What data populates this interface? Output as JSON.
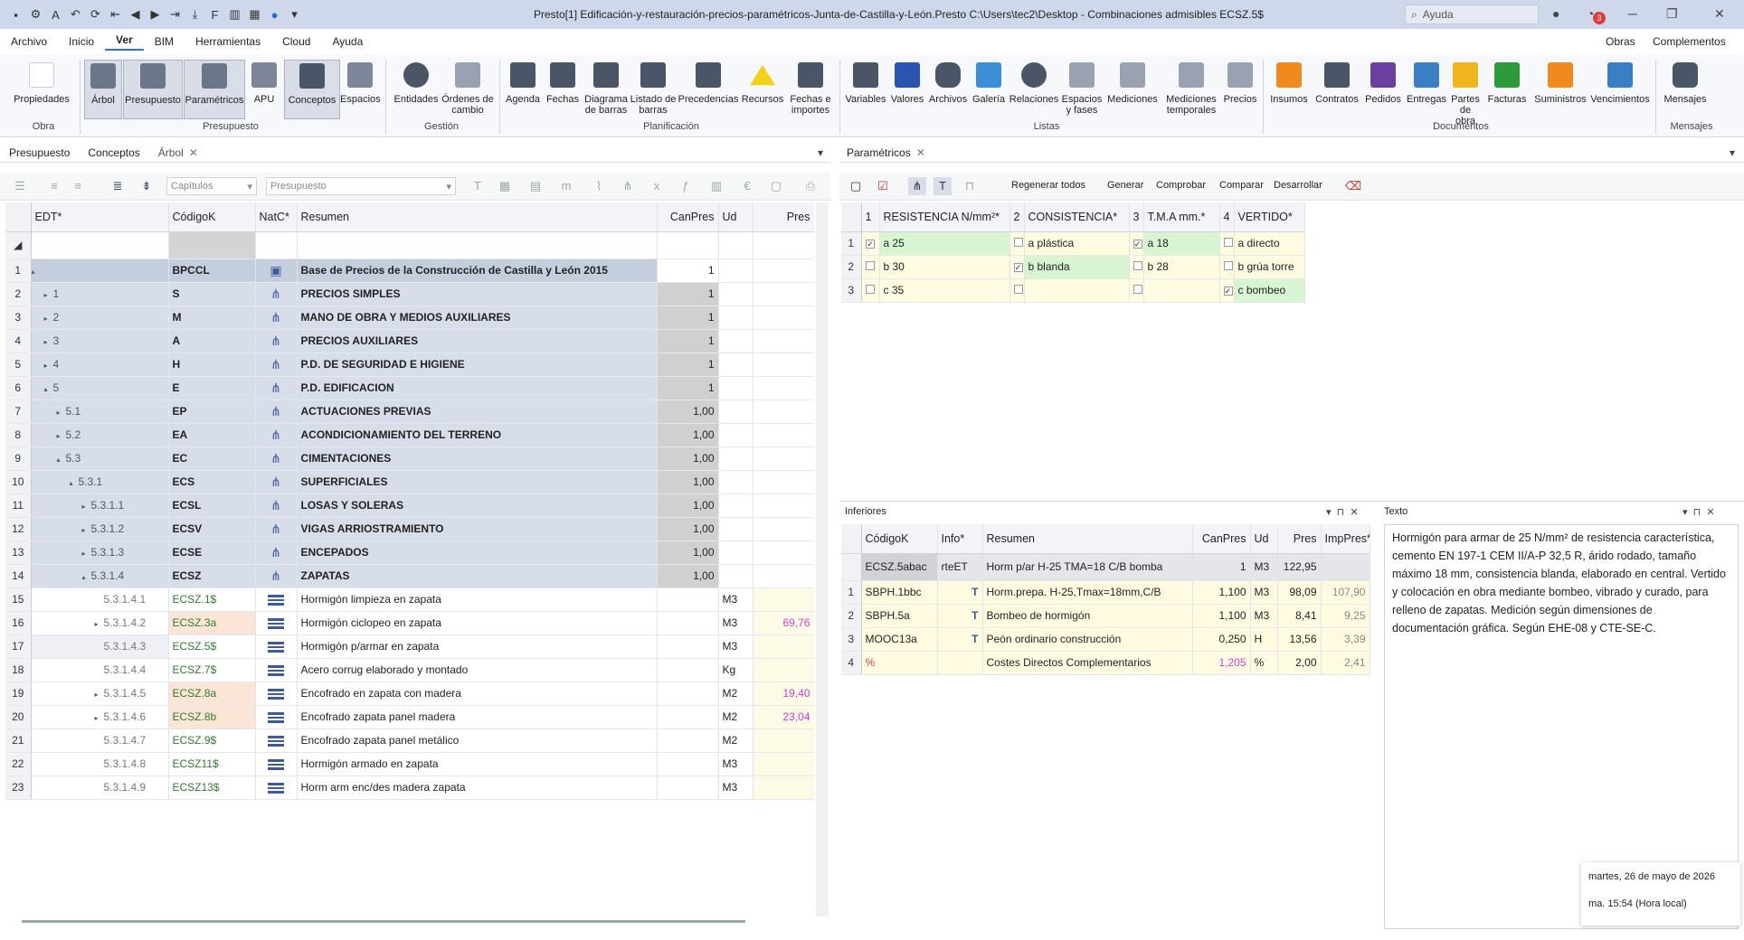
{
  "titlebar": {
    "title": "Presto[1] Edificación-y-restauración-precios-paramétricos-Junta-de-Castilla-y-León.Presto C:\\Users\\tec2\\Desktop - Combinaciones admisibles ECSZ.5$",
    "help_placeholder": "Ayuda",
    "notif_count": "3"
  },
  "menu": {
    "items": [
      "Archivo",
      "Inicio",
      "Ver",
      "BIM",
      "Herramientas",
      "Cloud",
      "Ayuda"
    ],
    "right": [
      "Obras",
      "Complementos"
    ]
  },
  "ribbon": {
    "buttons": [
      "Propiedades",
      "Árbol",
      "Presupuesto",
      "Paramétricos",
      "APU",
      "Conceptos",
      "Espacios",
      "Entidades",
      "Órdenes de cambio",
      "Agenda",
      "Fechas",
      "Diagrama de barras",
      "Listado de barras",
      "Precedencias",
      "Recursos",
      "Fechas e importes",
      "Variables",
      "Valores",
      "Archivos",
      "Galería",
      "Relaciones",
      "Espacios y fases",
      "Mediciones",
      "Mediciones temporales",
      "Precios",
      "Insumos",
      "Contratos",
      "Pedidos",
      "Entregas",
      "Partes de obra",
      "Facturas",
      "Suministros",
      "Vencimientos",
      "Mensajes"
    ],
    "groups": [
      "Obra",
      "Presupuesto",
      "Gestión",
      "Planificación",
      "Listas",
      "Documentos",
      "Mensajes"
    ]
  },
  "left_tabs": [
    "Presupuesto",
    "Conceptos",
    "Árbol"
  ],
  "left_toolbar": {
    "sel1": "Capítulos",
    "sel2": "Presupuesto"
  },
  "tree_table": {
    "headers": [
      "EDT*",
      "CódigoK",
      "NatC*",
      "Resumen",
      "CanPres",
      "Ud",
      "Pres"
    ],
    "rows": [
      {
        "n": "1",
        "edt": "",
        "code": "BPCCL",
        "sum": "Base de Precios de la Construcción de Castilla y León 2015",
        "can": "1",
        "ud": "",
        "pres": ""
      },
      {
        "n": "2",
        "edt": "1",
        "code": "S",
        "sum": "PRECIOS SIMPLES",
        "can": "1",
        "ud": "",
        "pres": ""
      },
      {
        "n": "3",
        "edt": "2",
        "code": "M",
        "sum": "MANO DE OBRA Y MEDIOS AUXILIARES",
        "can": "1",
        "ud": "",
        "pres": ""
      },
      {
        "n": "4",
        "edt": "3",
        "code": "A",
        "sum": "PRECIOS AUXILIARES",
        "can": "1",
        "ud": "",
        "pres": ""
      },
      {
        "n": "5",
        "edt": "4",
        "code": "H",
        "sum": "P.D. DE SEGURIDAD E HIGIENE",
        "can": "1",
        "ud": "",
        "pres": ""
      },
      {
        "n": "6",
        "edt": "5",
        "code": "E",
        "sum": "P.D. EDIFICACION",
        "can": "1",
        "ud": "",
        "pres": ""
      },
      {
        "n": "7",
        "edt": "5.1",
        "code": "EP",
        "sum": "ACTUACIONES PREVIAS",
        "can": "1,00",
        "ud": "",
        "pres": ""
      },
      {
        "n": "8",
        "edt": "5.2",
        "code": "EA",
        "sum": "ACONDICIONAMIENTO DEL TERRENO",
        "can": "1,00",
        "ud": "",
        "pres": ""
      },
      {
        "n": "9",
        "edt": "5.3",
        "code": "EC",
        "sum": "CIMENTACIONES",
        "can": "1,00",
        "ud": "",
        "pres": ""
      },
      {
        "n": "10",
        "edt": "5.3.1",
        "code": "ECS",
        "sum": "SUPERFICIALES",
        "can": "1,00",
        "ud": "",
        "pres": ""
      },
      {
        "n": "11",
        "edt": "5.3.1.1",
        "code": "ECSL",
        "sum": "LOSAS Y SOLERAS",
        "can": "1,00",
        "ud": "",
        "pres": ""
      },
      {
        "n": "12",
        "edt": "5.3.1.2",
        "code": "ECSV",
        "sum": "VIGAS ARRIOSTRAMIENTO",
        "can": "1,00",
        "ud": "",
        "pres": ""
      },
      {
        "n": "13",
        "edt": "5.3.1.3",
        "code": "ECSE",
        "sum": "ENCEPADOS",
        "can": "1,00",
        "ud": "",
        "pres": ""
      },
      {
        "n": "14",
        "edt": "5.3.1.4",
        "code": "ECSZ",
        "sum": "ZAPATAS",
        "can": "1,00",
        "ud": "",
        "pres": ""
      },
      {
        "n": "15",
        "edt": "5.3.1.4.1",
        "code": "ECSZ.1$",
        "sum": "Hormigón limpieza en zapata",
        "can": "",
        "ud": "M3",
        "pres": ""
      },
      {
        "n": "16",
        "edt": "5.3.1.4.2",
        "code": "ECSZ.3a",
        "sum": "Hormigón ciclopeo en zapata",
        "can": "",
        "ud": "M3",
        "pres": "69,76"
      },
      {
        "n": "17",
        "edt": "5.3.1.4.3",
        "code": "ECSZ.5$",
        "sum": "Hormigón p/armar en zapata",
        "can": "",
        "ud": "M3",
        "pres": ""
      },
      {
        "n": "18",
        "edt": "5.3.1.4.4",
        "code": "ECSZ.7$",
        "sum": "Acero corrug elaborado y montado",
        "can": "",
        "ud": "Kg",
        "pres": ""
      },
      {
        "n": "19",
        "edt": "5.3.1.4.5",
        "code": "ECSZ.8a",
        "sum": "Encofrado en zapata con madera",
        "can": "",
        "ud": "M2",
        "pres": "19,40"
      },
      {
        "n": "20",
        "edt": "5.3.1.4.6",
        "code": "ECSZ.8b",
        "sum": "Encofrado zapata panel madera",
        "can": "",
        "ud": "M2",
        "pres": "23,04"
      },
      {
        "n": "21",
        "edt": "5.3.1.4.7",
        "code": "ECSZ.9$",
        "sum": "Encofrado zapata panel metálico",
        "can": "",
        "ud": "M2",
        "pres": ""
      },
      {
        "n": "22",
        "edt": "5.3.1.4.8",
        "code": "ECSZ11$",
        "sum": "Hormigón armado en zapata",
        "can": "",
        "ud": "M3",
        "pres": ""
      },
      {
        "n": "23",
        "edt": "5.3.1.4.9",
        "code": "ECSZ13$",
        "sum": "Horm arm enc/des madera zapata",
        "can": "",
        "ud": "M3",
        "pres": ""
      }
    ]
  },
  "param": {
    "tab": "Paramétricos",
    "toolbar": [
      "Regenerar todos",
      "Generar",
      "Comprobar",
      "Comparar",
      "Desarrollar"
    ],
    "headers": [
      "1",
      "RESISTENCIA N/mm²*",
      "2",
      "CONSISTENCIA*",
      "3",
      "T.M.A mm.*",
      "4",
      "VERTIDO*"
    ],
    "rows": [
      {
        "n": "1",
        "c1": "a 25",
        "c2": "a plástica",
        "c3": "a 18",
        "c4": "a directo",
        "k": [
          true,
          false,
          true,
          false
        ]
      },
      {
        "n": "2",
        "c1": "b 30",
        "c2": "b blanda",
        "c3": "b 28",
        "c4": "b grúa torre",
        "k": [
          false,
          true,
          false,
          false
        ]
      },
      {
        "n": "3",
        "c1": "c 35",
        "c2": "",
        "c3": "",
        "c4": "c bombeo",
        "k": [
          false,
          false,
          false,
          true
        ]
      }
    ]
  },
  "inferiores": {
    "title": "Inferiores",
    "headers": [
      "CódigoK",
      "Info*",
      "Resumen",
      "CanPres",
      "Ud",
      "Pres",
      "ImpPres*"
    ],
    "parent": {
      "code": "ECSZ.5abac",
      "info": "rteET",
      "sum": "Horm p/ar H-25 TMA=18 C/B bomba",
      "can": "1",
      "ud": "M3",
      "pres": "122,95"
    },
    "rows": [
      {
        "n": "1",
        "code": "SBPH.1bbc",
        "sum": "Horm.prepa. H-25,Tmax=18mm,C/B",
        "can": "1,100",
        "ud": "M3",
        "pres": "98,09",
        "imp": "107,90"
      },
      {
        "n": "2",
        "code": "SBPH.5a",
        "sum": "Bombeo de hormigón",
        "can": "1,100",
        "ud": "M3",
        "pres": "8,41",
        "imp": "9,25"
      },
      {
        "n": "3",
        "code": "MOOC13a",
        "sum": "Peón ordinario construcción",
        "can": "0,250",
        "ud": "H",
        "pres": "13,56",
        "imp": "3,39"
      },
      {
        "n": "4",
        "code": "%",
        "sum": "Costes Directos Complementarios",
        "can": "1,205",
        "ud": "%",
        "pres": "2,00",
        "imp": "2,41"
      }
    ]
  },
  "texto": {
    "title": "Texto",
    "body": "Hormigón para armar de 25 N/mm² de resistencia característica, cemento EN 197-1 CEM II/A-P 32,5 R, árido rodado, tamaño máximo 18 mm, consistencia blanda, elaborado en central. Vertido y colocación en obra mediante bombeo, vibrado y curado, para relleno de zapatas. Medición según dimensiones de documentación gráfica. Según EHE-08 y CTE-SE-C."
  },
  "clock": {
    "date": "martes, 26 de mayo de 2026",
    "time": "ma. 15:54 (Hora local)"
  }
}
